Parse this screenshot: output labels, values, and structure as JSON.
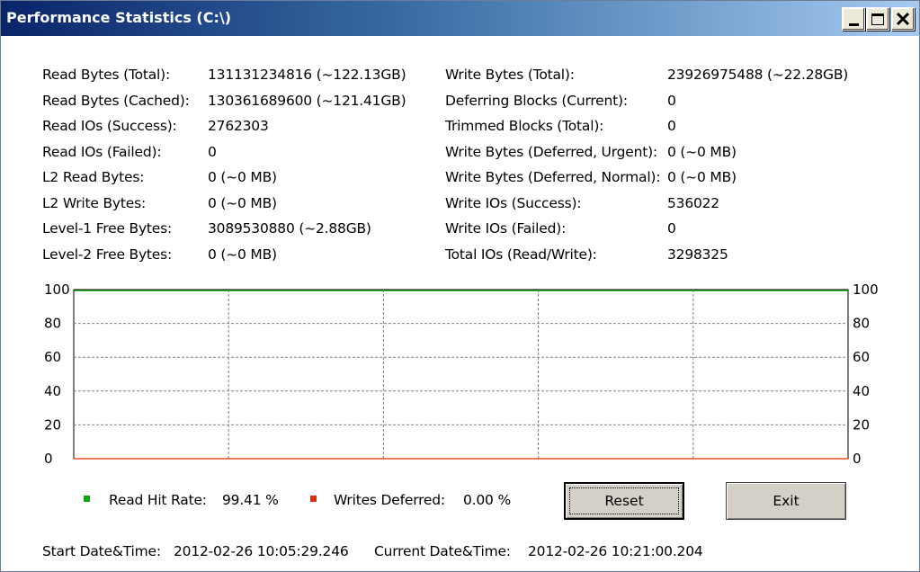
{
  "window": {
    "title": "Performance Statistics (C:\\)"
  },
  "left_stats": [
    {
      "label": "Read Bytes (Total):",
      "value": "131131234816 (~122.13GB)"
    },
    {
      "label": "Read Bytes (Cached):",
      "value": "130361689600 (~121.41GB)"
    },
    {
      "label": "Read IOs (Success):",
      "value": "2762303"
    },
    {
      "label": "Read IOs (Failed):",
      "value": "0"
    },
    {
      "label": "L2 Read Bytes:",
      "value": "0 (~0 MB)"
    },
    {
      "label": "L2 Write Bytes:",
      "value": "0 (~0 MB)"
    },
    {
      "label": "Level-1 Free Bytes:",
      "value": "3089530880 (~2.88GB)"
    },
    {
      "label": "Level-2 Free Bytes:",
      "value": "0 (~0 MB)"
    }
  ],
  "right_stats": [
    {
      "label": "Write Bytes (Total):",
      "value": "23926975488 (~22.28GB)"
    },
    {
      "label": "Deferring Blocks (Current):",
      "value": "0"
    },
    {
      "label": "Trimmed Blocks (Total):",
      "value": "0"
    },
    {
      "label": "Write Bytes (Deferred, Urgent):",
      "value": "0 (~0 MB)"
    },
    {
      "label": "Write Bytes (Deferred, Normal):",
      "value": "0 (~0 MB)"
    },
    {
      "label": "Write IOs (Success):",
      "value": "536022"
    },
    {
      "label": "Write IOs (Failed):",
      "value": "0"
    },
    {
      "label": "Total IOs (Read/Write):",
      "value": "3298325"
    }
  ],
  "chart_data": {
    "type": "line",
    "ylim": [
      0,
      100
    ],
    "yticks": [
      "0",
      "20",
      "40",
      "60",
      "80",
      "100"
    ],
    "grid": true,
    "series": [
      {
        "name": "Read Hit Rate",
        "color": "#00b000",
        "values": [
          99.41,
          99.41
        ]
      },
      {
        "name": "Writes Deferred",
        "color": "#e03000",
        "values": [
          0,
          0
        ]
      }
    ]
  },
  "legend": {
    "read_label": "Read Hit Rate:",
    "read_value": "99.41 %",
    "read_color": "#00b000",
    "write_label": "Writes Deferred:",
    "write_value": "0.00 %",
    "write_color": "#e03000"
  },
  "buttons": {
    "reset": "Reset",
    "exit": "Exit"
  },
  "footer": {
    "start_label": "Start Date&Time:",
    "start_value": "2012-02-26 10:05:29.246",
    "current_label": "Current Date&Time:",
    "current_value": "2012-02-26 10:21:00.204"
  }
}
